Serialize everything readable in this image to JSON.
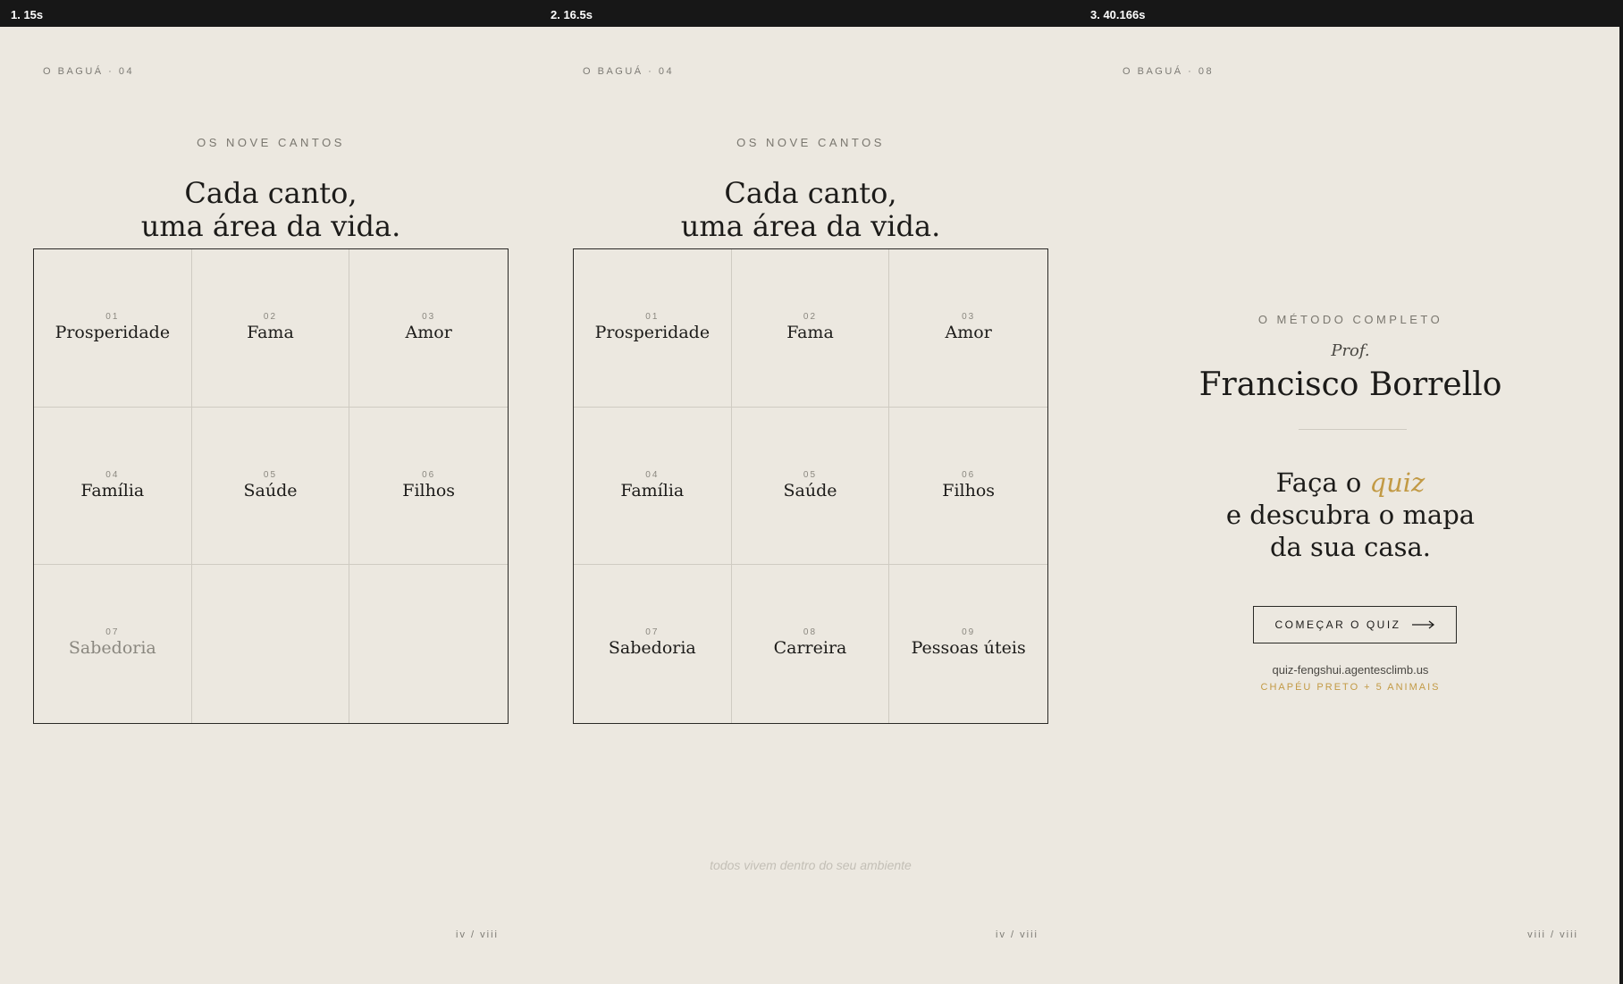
{
  "panels": [
    {
      "header": "1. 15s",
      "kicker": "O BAGUÁ · 04",
      "eyebrow": "OS NOVE CANTOS",
      "title_line1": "Cada canto,",
      "title_line2": "uma área da vida.",
      "cells": [
        {
          "num": "01",
          "label": "Prosperidade"
        },
        {
          "num": "02",
          "label": "Fama"
        },
        {
          "num": "03",
          "label": "Amor"
        },
        {
          "num": "04",
          "label": "Família"
        },
        {
          "num": "05",
          "label": "Saúde"
        },
        {
          "num": "06",
          "label": "Filhos"
        },
        {
          "num": "07",
          "label": "Sabedoria"
        },
        {
          "num": "",
          "label": ""
        },
        {
          "num": "",
          "label": ""
        }
      ],
      "pager": "iv / viii"
    },
    {
      "header": "2. 16.5s",
      "kicker": "O BAGUÁ · 04",
      "eyebrow": "OS NOVE CANTOS",
      "title_line1": "Cada canto,",
      "title_line2": "uma área da vida.",
      "cells": [
        {
          "num": "01",
          "label": "Prosperidade"
        },
        {
          "num": "02",
          "label": "Fama"
        },
        {
          "num": "03",
          "label": "Amor"
        },
        {
          "num": "04",
          "label": "Família"
        },
        {
          "num": "05",
          "label": "Saúde"
        },
        {
          "num": "06",
          "label": "Filhos"
        },
        {
          "num": "07",
          "label": "Sabedoria"
        },
        {
          "num": "08",
          "label": "Carreira"
        },
        {
          "num": "09",
          "label": "Pessoas úteis"
        }
      ],
      "caption": "todos vivem dentro do seu ambiente",
      "pager": "iv / viii"
    },
    {
      "header": "3. 40.166s",
      "kicker": "O BAGUÁ · 08",
      "eyebrow": "O MÉTODO COMPLETO",
      "prof": "Prof.",
      "name": "Francisco Borrello",
      "cta_pre": "Faça o ",
      "cta_highlight": "quiz",
      "cta_line2": "e descubra o mapa",
      "cta_line3": "da sua casa.",
      "button_label": "COMEÇAR O QUIZ",
      "button_icon": "arrow-right-icon",
      "url": "quiz-fengshui.agentesclimb.us",
      "sub": "CHAPÉU PRETO + 5 ANIMAIS",
      "pager": "viii / viii"
    }
  ],
  "colors": {
    "background": "#ece8e0",
    "ink": "#1c1b19",
    "accent": "#c29a45",
    "frame": "#171717"
  }
}
